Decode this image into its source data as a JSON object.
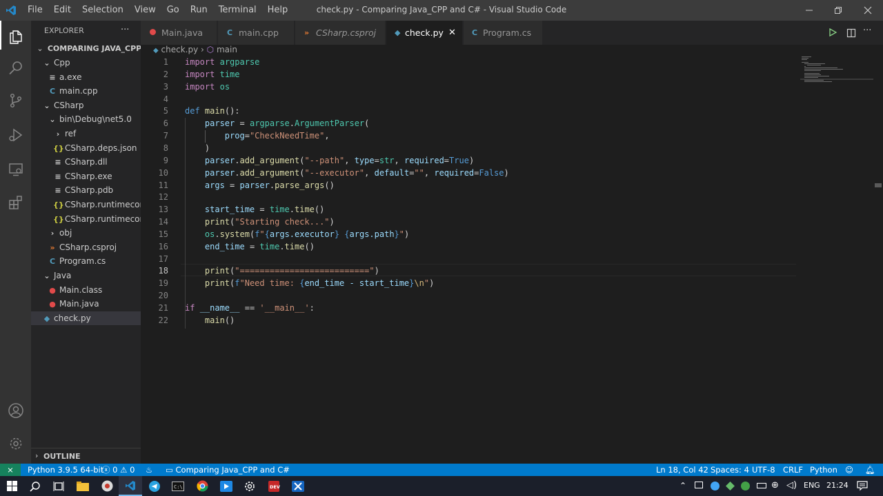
{
  "window": {
    "title": "check.py - Comparing Java_CPP and C# - Visual Studio Code",
    "menu": [
      "File",
      "Edit",
      "Selection",
      "View",
      "Go",
      "Run",
      "Terminal",
      "Help"
    ]
  },
  "explorer": {
    "header": "EXPLORER",
    "root": "COMPARING JAVA_CPP A...",
    "items": [
      {
        "label": "Cpp",
        "icon": "chevron-down"
      },
      {
        "label": "a.exe",
        "icon": "binary-file"
      },
      {
        "label": "main.cpp",
        "icon": "cpp-file"
      },
      {
        "label": "CSharp",
        "icon": "chevron-down"
      },
      {
        "label": "bin\\Debug\\net5.0",
        "icon": "chevron-down"
      },
      {
        "label": "ref",
        "icon": "chevron-right"
      },
      {
        "label": "CSharp.deps.json",
        "icon": "json-file"
      },
      {
        "label": "CSharp.dll",
        "icon": "binary-file"
      },
      {
        "label": "CSharp.exe",
        "icon": "binary-file"
      },
      {
        "label": "CSharp.pdb",
        "icon": "binary-file"
      },
      {
        "label": "CSharp.runtimecon...",
        "icon": "json-file"
      },
      {
        "label": "CSharp.runtimecon...",
        "icon": "json-file"
      },
      {
        "label": "obj",
        "icon": "chevron-right"
      },
      {
        "label": "CSharp.csproj",
        "icon": "rss-file"
      },
      {
        "label": "Program.cs",
        "icon": "csharp-file"
      },
      {
        "label": "Java",
        "icon": "chevron-down"
      },
      {
        "label": "Main.class",
        "icon": "java-file"
      },
      {
        "label": "Main.java",
        "icon": "java-file"
      },
      {
        "label": "check.py",
        "icon": "python-file"
      }
    ],
    "outline": "OUTLINE"
  },
  "tabs": [
    {
      "label": "Main.java",
      "icon": "java-file"
    },
    {
      "label": "main.cpp",
      "icon": "cpp-file"
    },
    {
      "label": "CSharp.csproj",
      "icon": "rss-file"
    },
    {
      "label": "check.py",
      "icon": "python-file",
      "active": true
    },
    {
      "label": "Program.cs",
      "icon": "csharp-file"
    }
  ],
  "breadcrumb": {
    "file": "check.py",
    "symbol": "main"
  },
  "editor": {
    "current_line": 18,
    "line_numbers": [
      "1",
      "2",
      "3",
      "4",
      "5",
      "6",
      "7",
      "8",
      "9",
      "10",
      "11",
      "12",
      "13",
      "14",
      "15",
      "16",
      "17",
      "18",
      "19",
      "20",
      "21",
      "22"
    ],
    "lines": [
      "import argparse",
      "import time",
      "import os",
      "",
      "def main():",
      "    parser = argparse.ArgumentParser(",
      "        prog=\"CheckNeedTime\",",
      "    )",
      "    parser.add_argument(\"--path\", type=str, required=True)",
      "    parser.add_argument(\"--executor\", default=\"\", required=False)",
      "    args = parser.parse_args()",
      "",
      "    start_time = time.time()",
      "    print(\"Starting check...\")",
      "    os.system(f\"{args.executor} {args.path}\")",
      "    end_time = time.time()",
      "",
      "    print(\"==========================\")",
      "    print(f\"Need time: {end_time - start_time}\\n\")",
      "",
      "if __name__ == '__main__':",
      "    main()"
    ]
  },
  "status": {
    "python": "Python 3.9.5 64-bit",
    "errors": "0",
    "warnings": "0",
    "folder": "Comparing Java_CPP and C#",
    "position": "Ln 18, Col 42",
    "spaces": "Spaces: 4",
    "encoding": "UTF-8",
    "eol": "CRLF",
    "language": "Python"
  },
  "taskbar": {
    "lang": "ENG",
    "time": "21:24"
  },
  "colors": {
    "statusbar": "#007acc",
    "activity": "#333333",
    "sidebar": "#252526",
    "editor": "#1e1e1e",
    "titlebar": "#3c3c3c"
  }
}
